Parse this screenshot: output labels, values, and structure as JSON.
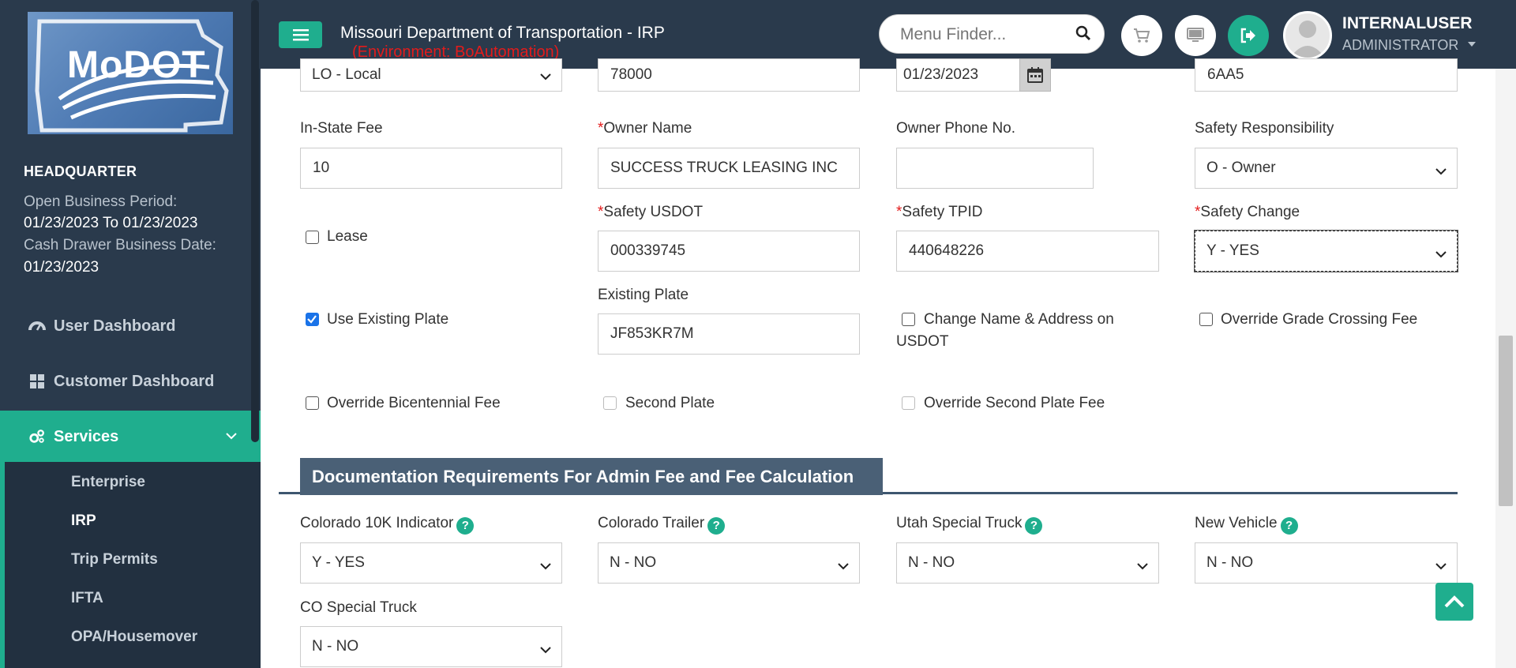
{
  "sidebar": {
    "logo_text": "MoDOT",
    "office": "HEADQUARTER",
    "open_business_label": "Open Business Period:",
    "open_business_value": "01/23/2023 To 01/23/2023",
    "cash_drawer_label": "Cash Drawer Business Date:",
    "cash_drawer_value": "01/23/2023",
    "nav": {
      "user_dashboard": "User Dashboard",
      "customer_dashboard": "Customer Dashboard",
      "services": "Services"
    },
    "sub_items": [
      "Enterprise",
      "IRP",
      "Trip Permits",
      "IFTA",
      "OPA/Housemover"
    ]
  },
  "header": {
    "title": "Missouri Department of Transportation - IRP",
    "environment": "(Environment: BoAutomation)",
    "menu_finder_placeholder": "Menu Finder...",
    "user_name": "INTERNALUSER",
    "user_role": "ADMINISTRATOR"
  },
  "form": {
    "row0": {
      "select_value": "LO - Local",
      "field2_value": "78000",
      "date_value": "01/23/2023",
      "field4_value": "6AA5"
    },
    "in_state_fee_label": "In-State Fee",
    "in_state_fee_value": "10",
    "owner_name_label": "Owner Name",
    "owner_name_value": "SUCCESS TRUCK LEASING INC",
    "owner_phone_label": "Owner Phone No.",
    "owner_phone_value": "",
    "safety_responsibility_label": "Safety Responsibility",
    "safety_responsibility_value": "O - Owner",
    "lease_label": "Lease",
    "safety_usdot_label": "Safety USDOT",
    "safety_usdot_value": "000339745",
    "safety_tpid_label": "Safety TPID",
    "safety_tpid_value": "440648226",
    "safety_change_label": "Safety Change",
    "safety_change_value": "Y - YES",
    "use_existing_plate_label": "Use Existing Plate",
    "existing_plate_label": "Existing Plate",
    "existing_plate_value": "JF853KR7M",
    "change_name_label_1": "Change Name & Address on",
    "change_name_label_2": "USDOT",
    "override_grade_label": "Override Grade Crossing Fee",
    "override_bicentennial_label": "Override Bicentennial Fee",
    "second_plate_label": "Second Plate",
    "override_second_plate_label": "Override Second Plate Fee",
    "required_mark": "*"
  },
  "docs": {
    "section_title": "Documentation Requirements For Admin Fee and Fee Calculation",
    "help_glyph": "?",
    "colorado_10k_label": "Colorado 10K Indicator",
    "colorado_10k_value": "Y - YES",
    "colorado_trailer_label": "Colorado Trailer",
    "colorado_trailer_value": "N - NO",
    "utah_special_label": "Utah Special Truck",
    "utah_special_value": "N - NO",
    "new_vehicle_label": "New Vehicle",
    "new_vehicle_value": "N - NO",
    "co_special_label": "CO Special Truck",
    "co_special_value": "N - NO"
  },
  "colors": {
    "sidebar_bg": "#2a3a4c",
    "accent": "#1fae8e",
    "env_red": "#e31b1b",
    "section_bg": "#4a6076"
  }
}
